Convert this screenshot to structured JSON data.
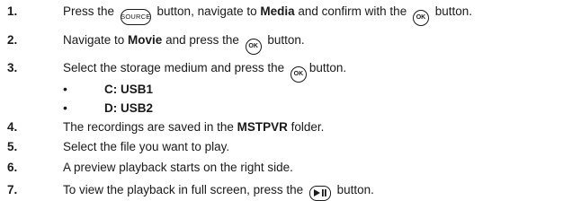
{
  "steps": [
    {
      "num": "1.",
      "t1": "Press the ",
      "icon1": "SOURCE",
      "t2": " button, navigate to ",
      "b1": "Media",
      "t3": " and confirm with the ",
      "icon2": "OK",
      "t4": " button."
    },
    {
      "num": "2.",
      "t1": "Navigate to ",
      "b1": "Movie",
      "t2": " and press the ",
      "icon1": "OK",
      "t3": " button."
    },
    {
      "num": "3.",
      "t1": "Select the storage medium and press the ",
      "icon1": "OK",
      "t2": "button."
    },
    {
      "num": "4.",
      "t1": "The recordings are saved in the ",
      "b1": "MSTPVR",
      "t2": " folder."
    },
    {
      "num": "5.",
      "t1": "Select the file you want to play."
    },
    {
      "num": "6.",
      "t1": "A preview playback starts on the right side."
    },
    {
      "num": "7.",
      "t1": "To view the playback in full screen, press the ",
      "icon1": "play-pause-icon",
      "t2": " button."
    }
  ],
  "bullets": [
    "C: USB1",
    "D: USB2"
  ],
  "bullet_glyph": "•"
}
